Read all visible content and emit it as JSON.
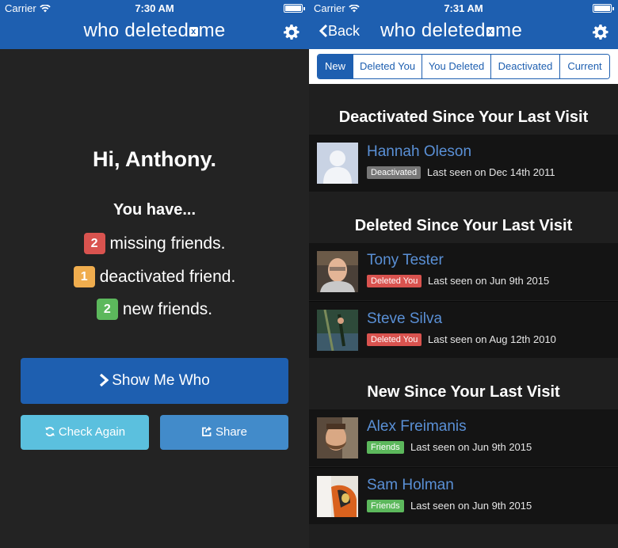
{
  "left": {
    "status": {
      "carrier": "Carrier",
      "time": "7:30 AM"
    },
    "brand": {
      "pre": "who deleted",
      "x": "x",
      "post": "me"
    },
    "greeting": "Hi, Anthony.",
    "you_have": "You have...",
    "stats": [
      {
        "count": "2",
        "text": "missing friends.",
        "color": "#d9534f"
      },
      {
        "count": "1",
        "text": "deactivated friend.",
        "color": "#f0ad4e"
      },
      {
        "count": "2",
        "text": "new friends.",
        "color": "#5cb85c"
      }
    ],
    "buttons": {
      "show": "Show Me Who",
      "check": "Check Again",
      "share": "Share"
    }
  },
  "right": {
    "status": {
      "carrier": "Carrier",
      "time": "7:31 AM"
    },
    "brand": {
      "pre": "who deleted",
      "x": "x",
      "post": "me"
    },
    "back": "Back",
    "tabs": [
      "New",
      "Deleted You",
      "You Deleted",
      "Deactivated",
      "Current"
    ],
    "active_tab": "New",
    "sections": [
      {
        "title": "Deactivated Since Your Last Visit",
        "rows": [
          {
            "name": "Hannah Oleson",
            "tag": "Deactivated",
            "seen": "Last seen on Dec 14th 2011"
          }
        ]
      },
      {
        "title": "Deleted Since Your Last Visit",
        "rows": [
          {
            "name": "Tony Tester",
            "tag": "Deleted You",
            "seen": "Last seen on Jun 9th 2015"
          },
          {
            "name": "Steve Silva",
            "tag": "Deleted You",
            "seen": "Last seen on Aug 12th 2010"
          }
        ]
      },
      {
        "title": "New Since Your Last Visit",
        "rows": [
          {
            "name": "Alex Freimanis",
            "tag": "Friends",
            "seen": "Last seen on Jun 9th 2015"
          },
          {
            "name": "Sam Holman",
            "tag": "Friends",
            "seen": "Last seen on Jun 9th 2015"
          }
        ]
      }
    ]
  },
  "colors": {
    "brand_blue": "#1e5fb0",
    "link_blue": "#5a90d6",
    "danger": "#d9534f",
    "warning": "#f0ad4e",
    "success": "#5cb85c",
    "info": "#5bc0de"
  }
}
